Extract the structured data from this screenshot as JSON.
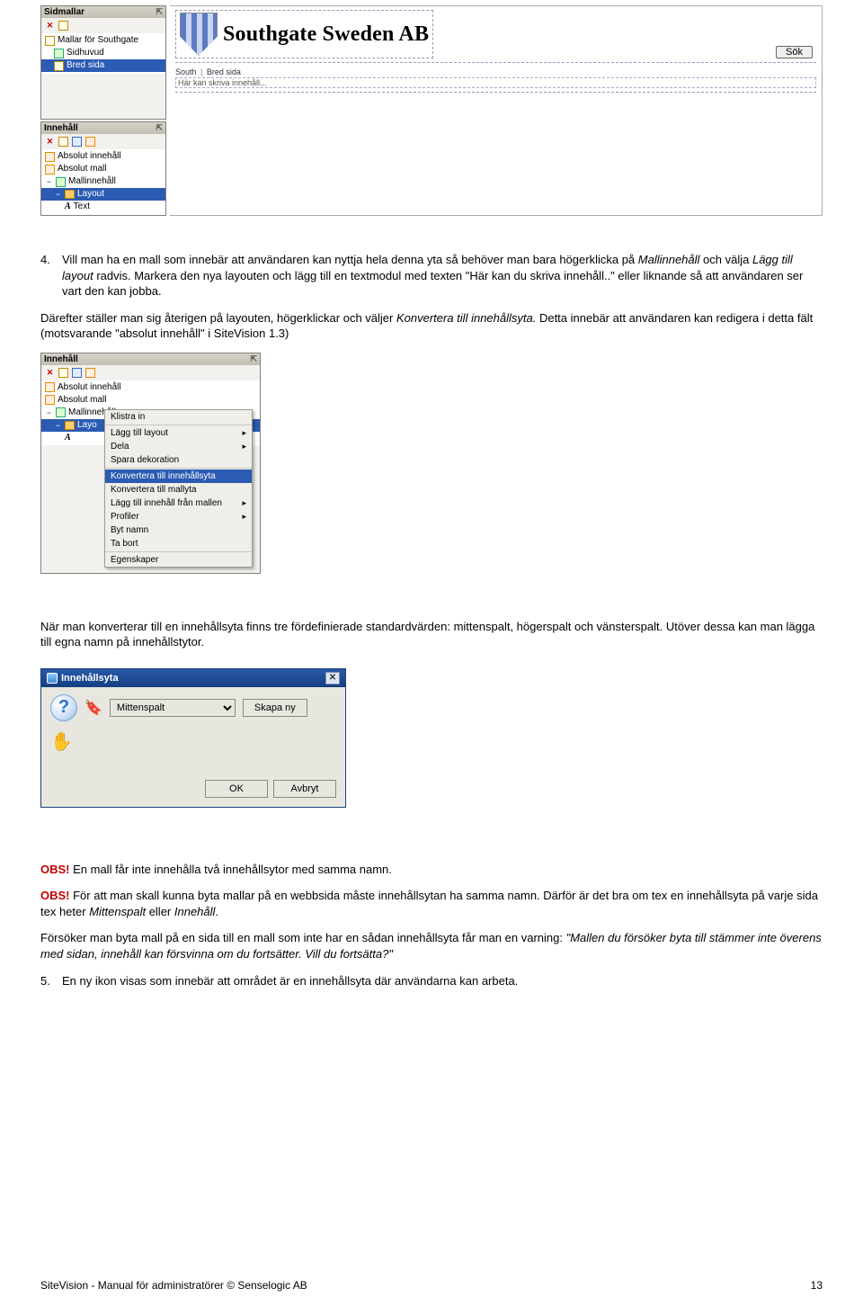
{
  "panels": {
    "sidmallar": {
      "title": "Sidmallar",
      "root": "Mallar för Southgate",
      "items": [
        "Sidhuvud",
        "Bred sida"
      ],
      "selected": "Bred sida"
    },
    "innehall": {
      "title": "Innehåll",
      "items": [
        {
          "label": "Absolut innehåll",
          "level": 0
        },
        {
          "label": "Absolut mall",
          "level": 0
        },
        {
          "label": "Mallinnehåll",
          "level": 0,
          "expand": "−"
        },
        {
          "label": "Layout",
          "level": 1,
          "sel": true,
          "expand": "−"
        },
        {
          "label": "Text",
          "level": 2,
          "aicon": true
        }
      ]
    }
  },
  "preview": {
    "company": "Southgate Sweden AB",
    "sok": "Sök",
    "crumb1": "South",
    "crumb2": "Bred sida",
    "hint": "Här kan skriva innehåll..."
  },
  "text": {
    "p4_num": "4.",
    "p4_a": "Vill man ha en mall som innebär att användaren kan nyttja hela denna yta så behöver man bara högerklicka på ",
    "p4_b": "Mallinnehåll",
    "p4_c": " och välja ",
    "p4_d": "Lägg till layout",
    "p4_e": " radvis. Markera den nya layouten och lägg till en textmodul med texten \"Här kan du skriva innehåll..\" eller liknande så att användaren ser vart den kan jobba.",
    "p4_2a": "Därefter ställer man sig återigen på layouten, högerklickar och väljer ",
    "p4_2b": "Konvertera till innehållsyta.",
    "p4_2c": " Detta innebär att användaren kan redigera i detta fält (motsvarande \"absolut innehåll\" i SiteVision 1.3)",
    "p5": "När man konverterar till en innehållsyta finns tre fördefinierade standardvärden: mittenspalt, högerspalt och vänsterspalt. Utöver dessa kan man lägga till egna namn på innehållstytor.",
    "obs1_label": "OBS!",
    "obs1": " En mall får inte innehålla två innehållsytor med samma namn.",
    "obs2_label": "OBS!",
    "obs2a": " För att man skall kunna byta mallar på en webbsida måste innehållsytan ha samma namn. Därför är det bra om tex en innehållsyta på varje sida tex heter ",
    "obs2b": "Mittenspalt",
    "obs2c": " eller ",
    "obs2d": "Innehåll",
    "obs2e": ".",
    "p6a": "Försöker man byta mall på en sida till en mall som inte har en sådan innehållsyta får man en varning: ",
    "p6b": "\"Mallen du försöker byta till stämmer inte överens med sidan, innehåll kan försvinna om du fortsätter. Vill du fortsätta?\"",
    "p7_num": "5.",
    "p7": "En ny ikon visas som innebär att området är en innehållsyta där användarna kan arbeta."
  },
  "ctx": {
    "title": "Innehåll",
    "tree": [
      {
        "label": "Absolut innehåll",
        "level": 0
      },
      {
        "label": "Absolut mall",
        "level": 0
      },
      {
        "label": "Mallinnehåll",
        "level": 0,
        "expand": "−"
      },
      {
        "label": "Layo",
        "level": 1,
        "sel": true,
        "expand": "−"
      },
      {
        "label": "",
        "level": 2,
        "aicon": true
      }
    ],
    "menu": {
      "klistra": "Klistra in",
      "lagg": "Lägg till layout",
      "dela": "Dela",
      "spara": "Spara dekoration",
      "konv1": "Konvertera till innehållsyta",
      "konv2": "Konvertera till mallyta",
      "lagg2": "Lägg till innehåll från mallen",
      "profiler": "Profiler",
      "byt": "Byt namn",
      "tabort": "Ta bort",
      "egensk": "Egenskaper"
    }
  },
  "dialog": {
    "title": "Innehållsyta",
    "option": "Mittenspalt",
    "skapa": "Skapa ny",
    "ok": "OK",
    "avbryt": "Avbryt"
  },
  "footer": {
    "left": "SiteVision - Manual för administratörer © Senselogic AB",
    "page": "13"
  }
}
